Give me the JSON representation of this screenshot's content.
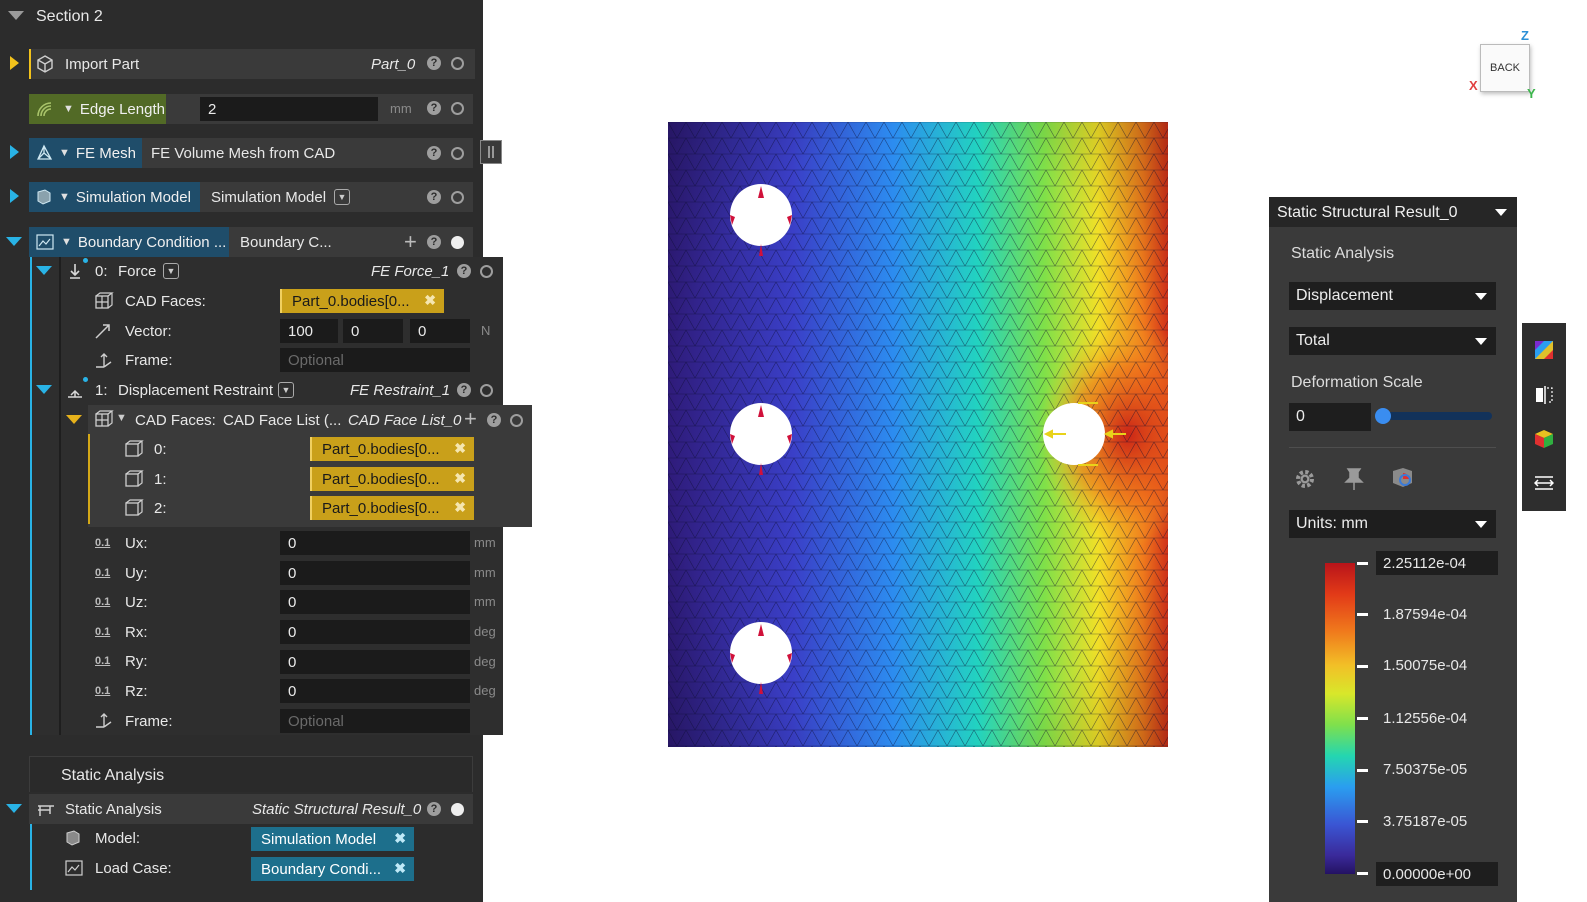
{
  "section": {
    "title": "Section 2"
  },
  "import_part": {
    "label": "Import Part",
    "value": "Part_0"
  },
  "edge_length": {
    "label": "Edge Length",
    "value": "2",
    "unit": "mm"
  },
  "fe_mesh": {
    "label": "FE Mesh",
    "value": "FE Volume Mesh from CAD"
  },
  "sim_model": {
    "label": "Simulation Model",
    "value": "Simulation Model"
  },
  "boundary": {
    "label": "Boundary Condition ...",
    "value": "Boundary C...",
    "force": {
      "index": "0:",
      "label": "Force",
      "value": "FE Force_1",
      "cad_faces_label": "CAD Faces:",
      "cad_faces_value": "Part_0.bodies[0...",
      "vector_label": "Vector:",
      "vector": [
        "100",
        "0",
        "0"
      ],
      "vector_unit": "N",
      "frame_label": "Frame:",
      "frame_placeholder": "Optional"
    },
    "restraint": {
      "index": "1:",
      "label": "Displacement Restraint",
      "value": "FE Restraint_1",
      "cad_faces_label": "CAD Faces:",
      "cad_faces_list": "CAD Face List (...",
      "cad_faces_list_value": "CAD Face List_0",
      "faces": [
        {
          "index": "0:",
          "value": "Part_0.bodies[0..."
        },
        {
          "index": "1:",
          "value": "Part_0.bodies[0..."
        },
        {
          "index": "2:",
          "value": "Part_0.bodies[0..."
        }
      ],
      "dofs": [
        {
          "label": "Ux:",
          "value": "0",
          "unit": "mm"
        },
        {
          "label": "Uy:",
          "value": "0",
          "unit": "mm"
        },
        {
          "label": "Uz:",
          "value": "0",
          "unit": "mm"
        },
        {
          "label": "Rx:",
          "value": "0",
          "unit": "deg"
        },
        {
          "label": "Ry:",
          "value": "0",
          "unit": "deg"
        },
        {
          "label": "Rz:",
          "value": "0",
          "unit": "deg"
        }
      ],
      "dof_icon_text": "0.1",
      "frame_label": "Frame:",
      "frame_placeholder": "Optional"
    }
  },
  "static_section": {
    "title": "Static Analysis"
  },
  "static_analysis": {
    "label": "Static Analysis",
    "value": "Static Structural Result_0",
    "model_label": "Model:",
    "model_value": "Simulation Model",
    "loadcase_label": "Load Case:",
    "loadcase_value": "Boundary Condi..."
  },
  "view_cube": {
    "face": "BACK",
    "axis_z": "Z",
    "axis_x": "X",
    "axis_y": "Y"
  },
  "result_panel": {
    "title": "Static Structural Result_0",
    "analysis": "Static Analysis",
    "quantity": "Displacement",
    "component": "Total",
    "deformation_label": "Deformation Scale",
    "deformation_value": "0",
    "deformation_fraction": 0.0,
    "units": "Units: mm",
    "legend": [
      "2.25112e-04",
      "1.87594e-04",
      "1.50075e-04",
      "1.12556e-04",
      "7.50375e-05",
      "3.75187e-05",
      "0.00000e+00"
    ]
  },
  "colors": {
    "accent_cyan": "#29b3e6",
    "accent_gold": "#f2c21b",
    "panel": "#2c2c2c"
  }
}
